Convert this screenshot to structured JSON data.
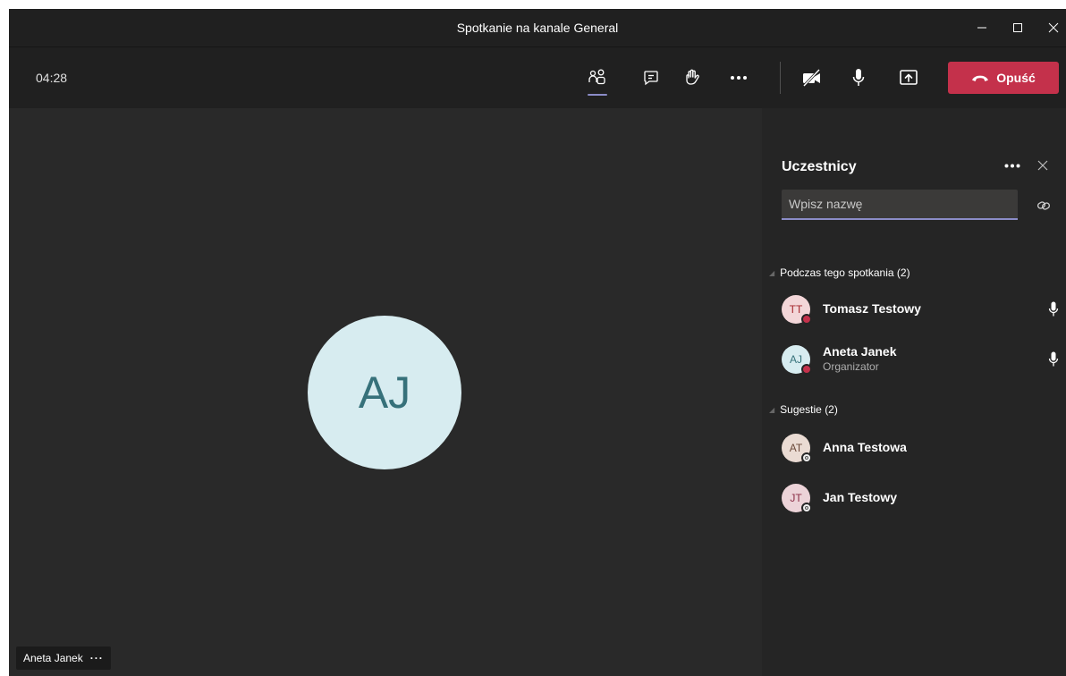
{
  "window": {
    "title": "Spotkanie na kanale General",
    "controls": [
      "minimize-icon",
      "maximize-icon",
      "close-icon"
    ]
  },
  "toolbar": {
    "timer": "04:28",
    "buttons": [
      "people-icon",
      "chat-icon",
      "raise-hand-icon",
      "more-icon",
      "camera-off-icon",
      "mic-icon",
      "share-screen-icon"
    ],
    "leave_label": "Opuść",
    "leave_color": "#c4314b",
    "accent": "#8b8cc7"
  },
  "stage": {
    "avatar_initials": "AJ",
    "name_chip": "Aneta Janek",
    "name_chip_more": "···"
  },
  "panel": {
    "title": "Uczestnicy",
    "search_placeholder": "Wpisz nazwę",
    "sections": [
      {
        "header": "Podczas tego spotkania (2)",
        "people": [
          {
            "initials": "TT",
            "name": "Tomasz Testowy",
            "role": ""
          },
          {
            "initials": "AJ",
            "name": "Aneta Janek",
            "role": "Organizator"
          }
        ]
      },
      {
        "header": "Sugestie (2)",
        "people": [
          {
            "initials": "AT",
            "name": "Anna Testowa",
            "role": ""
          },
          {
            "initials": "JT",
            "name": "Jan Testowy",
            "role": ""
          }
        ]
      }
    ]
  }
}
